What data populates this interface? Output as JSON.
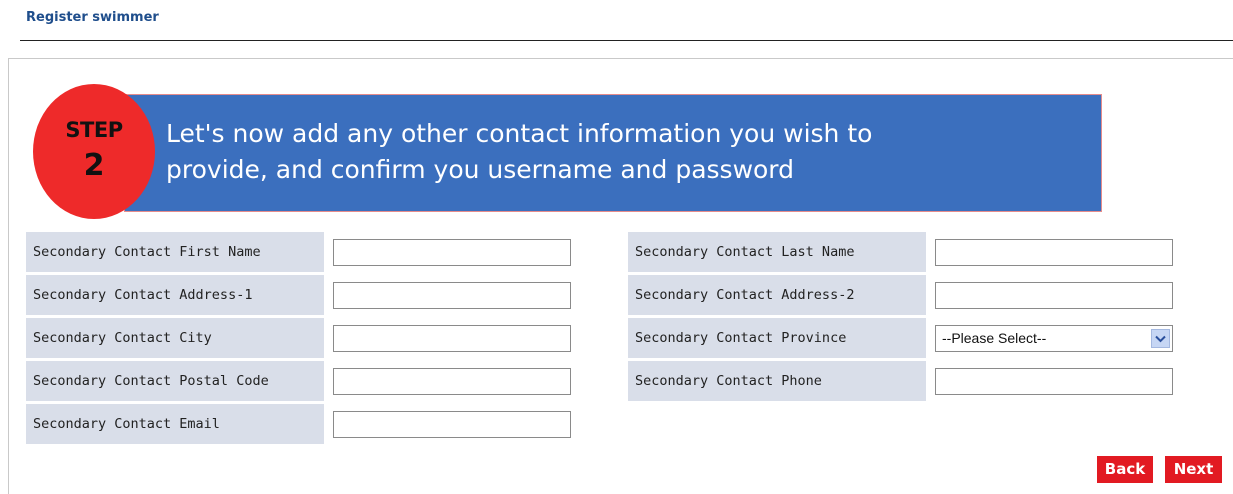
{
  "header": {
    "title": "Register swimmer"
  },
  "step": {
    "label": "STEP",
    "number": "2",
    "message": "Let's now add any other contact information you wish to\nprovide, and confirm you username and password"
  },
  "form": {
    "left": [
      {
        "label": "Secondary Contact First Name",
        "value": ""
      },
      {
        "label": "Secondary Contact Address-1",
        "value": ""
      },
      {
        "label": "Secondary Contact City",
        "value": ""
      },
      {
        "label": "Secondary Contact Postal Code",
        "value": ""
      },
      {
        "label": "Secondary Contact Email",
        "value": ""
      }
    ],
    "right": [
      {
        "label": "Secondary Contact Last Name",
        "value": ""
      },
      {
        "label": "Secondary Contact Address-2",
        "value": ""
      },
      {
        "label": "Secondary Contact Province",
        "selected": "--Please Select--"
      },
      {
        "label": "Secondary Contact Phone",
        "value": ""
      }
    ]
  },
  "buttons": {
    "back": "Back",
    "next": "Next"
  },
  "icons": {
    "select_arrow": "chevron-down-icon"
  },
  "colors": {
    "banner": "#3b6fbe",
    "badge": "#ee2a2a",
    "label_bg": "#d9dee9",
    "button": "#e21a22",
    "title": "#1f4e8c"
  }
}
